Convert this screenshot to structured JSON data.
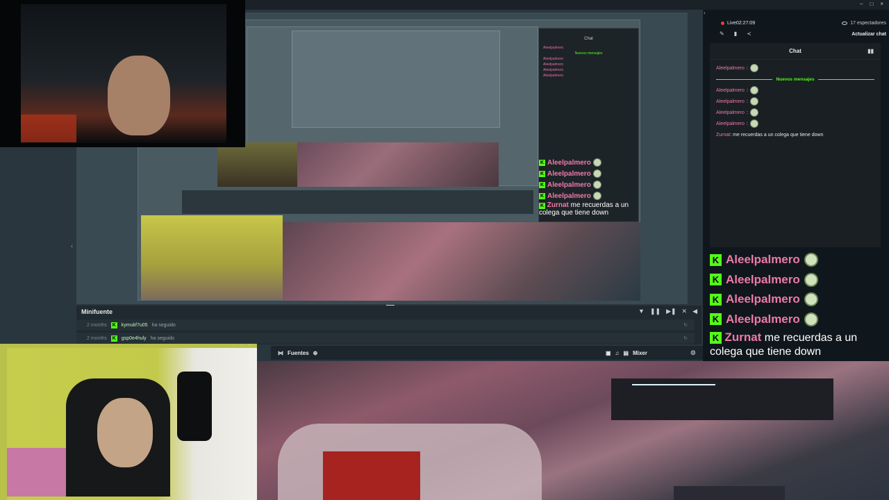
{
  "window": {
    "controls": [
      "–",
      "□",
      "×"
    ]
  },
  "stream_status": {
    "live_label": "Live",
    "live_time": "02:27:09",
    "viewers": "17 espectadores",
    "refresh_chat": "Actualizar chat"
  },
  "chat": {
    "title": "Chat",
    "new_messages_label": "Nuevos mensajes",
    "first_message": {
      "user": "Aleelpalmero",
      "text": ":"
    },
    "messages": [
      {
        "user": "Aleelpalmero",
        "text": ":"
      },
      {
        "user": "Aleelpalmero",
        "text": ":"
      },
      {
        "user": "Aleelpalmero",
        "text": ":"
      },
      {
        "user": "Aleelpalmero",
        "text": ":"
      }
    ],
    "last_message": {
      "user": "Zurnat",
      "text": ": me recuerdas a un colega que tiene down"
    }
  },
  "overlay_chat": {
    "lines": [
      {
        "user": "Aleelpalmero"
      },
      {
        "user": "Aleelpalmero"
      },
      {
        "user": "Aleelpalmero"
      },
      {
        "user": "Aleelpalmero"
      }
    ],
    "last": {
      "user": "Zurnat",
      "text": " me recuerdas a un colega que tiene down"
    }
  },
  "preview_chat": {
    "lines": [
      {
        "user": "Aleelpalmero"
      },
      {
        "user": "Aleelpalmero"
      },
      {
        "user": "Aleelpalmero"
      },
      {
        "user": "Aleelpalmero"
      }
    ],
    "last": {
      "user": "Zurnat",
      "text": " me recuerdas a un colega que tiene down"
    }
  },
  "minifuente": {
    "title": "Minifuente",
    "rows": [
      {
        "time": "2 months",
        "user": "kymukf7u05",
        "action": "ha seguido"
      },
      {
        "time": "2 months",
        "user": "gsp0e4huly",
        "action": "ha seguido"
      }
    ]
  },
  "fuentes_bar": {
    "fuentes": "Fuentes",
    "mixer": "Mixer"
  },
  "icons": [
    "pencil-icon",
    "folder-icon",
    "share-icon",
    "users-icon",
    "eye-icon",
    "filter-icon",
    "pause-icon",
    "skip-icon",
    "mute-icon",
    "volume-icon",
    "refresh-icon",
    "gear-icon",
    "add-icon",
    "chevron-left-icon",
    "chevron-right-icon"
  ],
  "colors": {
    "kick_green": "#53fc18",
    "username_pink": "#ee7aa8",
    "live_red": "#e0443c"
  }
}
